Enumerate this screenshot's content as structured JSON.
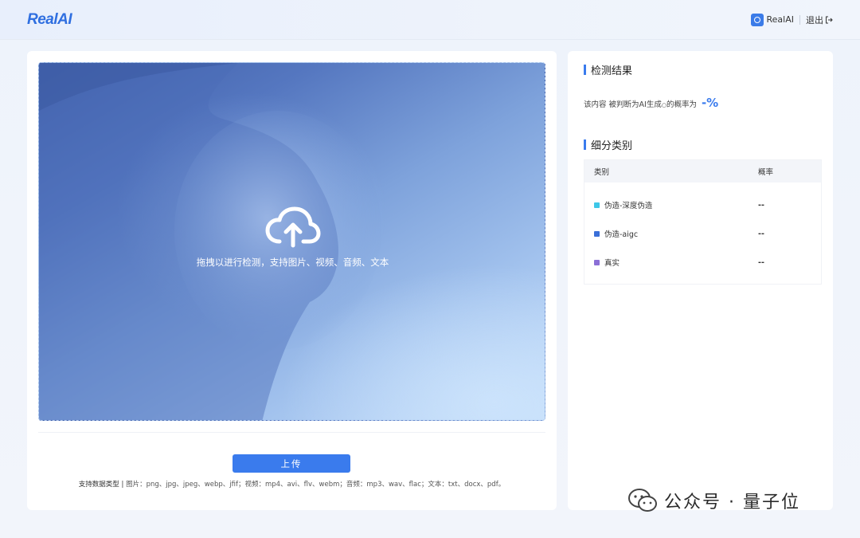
{
  "header": {
    "logo": "RealAI",
    "user_name": "RealAI",
    "logout_label": "退出"
  },
  "upload": {
    "hint": "拖拽以进行检测，支持图片、视频、音频、文本",
    "button_label": "上传",
    "formats_label": "支持数据类型 |",
    "formats_text": "图片：png、jpg、jpeg、webp、jfif；视频：mp4、avi、flv、webm；音频：mp3、wav、flac；文本：txt、docx、pdf。"
  },
  "result": {
    "title": "检测结果",
    "line_prefix": "该内容  被判断为AI生成",
    "line_suffix": "的概率为",
    "percent": "-%"
  },
  "categories": {
    "title": "细分类别",
    "col_category": "类别",
    "col_prob": "概率",
    "rows": [
      {
        "label": "伪造-深度伪造",
        "value": "--",
        "color": "#3ec7e8"
      },
      {
        "label": "伪造-aigc",
        "value": "--",
        "color": "#3a6fd8"
      },
      {
        "label": "真实",
        "value": "--",
        "color": "#8b6fd6"
      }
    ]
  },
  "watermark": {
    "text": "公众号 · 量子位"
  },
  "colors": {
    "accent": "#3a7bed"
  }
}
